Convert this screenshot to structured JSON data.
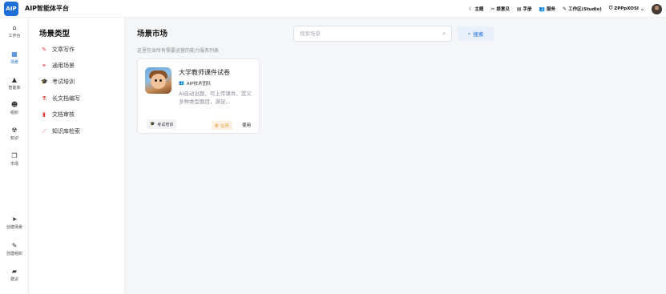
{
  "app": {
    "logo_text": "AIP",
    "title": "AIP智能体平台"
  },
  "top_nav": [
    {
      "icon": "moon-icon",
      "glyph": "☾",
      "label": "主题"
    },
    {
      "icon": "tools-icon",
      "glyph": "✂",
      "label": "提意见"
    },
    {
      "icon": "doc-icon",
      "glyph": "▤",
      "label": "手册"
    },
    {
      "icon": "users-icon",
      "glyph": "👥",
      "label": "服务"
    },
    {
      "icon": "brush-icon",
      "glyph": "✎",
      "label": "工作区(Studio)"
    },
    {
      "icon": "shield-icon",
      "glyph": "⛉",
      "label": "ZPPpXOSI"
    }
  ],
  "rail": [
    {
      "glyph": "⌂",
      "label": "工作台",
      "active": false
    },
    {
      "glyph": "▦",
      "label": "场景",
      "active": true
    },
    {
      "glyph": "▲",
      "label": "智能体",
      "active": false
    },
    {
      "glyph": "☻",
      "label": "组织",
      "active": false
    },
    {
      "glyph": "☢",
      "label": "知识",
      "active": false
    },
    {
      "glyph": "❐",
      "label": "市场",
      "active": false
    },
    {
      "glyph": "➤",
      "label": "创建场景",
      "active": false
    },
    {
      "glyph": "✎",
      "label": "创建组织",
      "active": false
    },
    {
      "glyph": "▰",
      "label": "建议",
      "active": false
    }
  ],
  "categories": {
    "title": "场景类型",
    "items": [
      {
        "glyph": "✎",
        "label": "文章写作"
      },
      {
        "glyph": "⚭",
        "label": "通用场景"
      },
      {
        "glyph": "🎓",
        "label": "考试培训"
      },
      {
        "glyph": "⚗",
        "label": "长文档编写"
      },
      {
        "glyph": "▮",
        "label": "文档审核"
      },
      {
        "glyph": "⟋",
        "label": "知识库检索"
      }
    ]
  },
  "main": {
    "title": "场景市场",
    "subtitle": "这里包含所有需要运营的能力服务列表",
    "search_placeholder": "搜索场景",
    "search_button": "搜索"
  },
  "card": {
    "title": "大学教师课件试卷",
    "team": "AIP技术团队",
    "description": "AI自动出题，可上传课件、定义多种类型题目，满足...",
    "tag": "考试培训",
    "visibility": "公开",
    "action": "使用"
  },
  "colors": {
    "accent": "#1f6fd6",
    "category_icon": "#e0403a",
    "public_badge": "#e58a1f"
  }
}
